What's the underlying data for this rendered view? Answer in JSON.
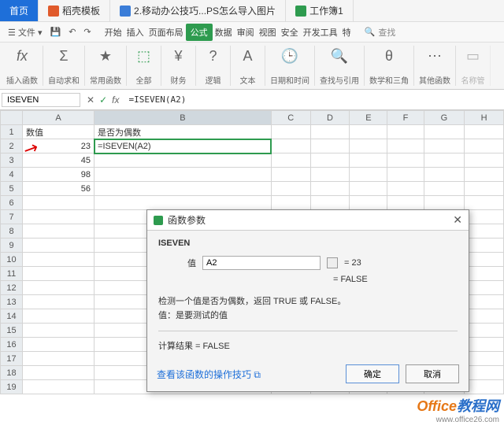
{
  "tabs": {
    "home": "首页",
    "t1": "稻壳模板",
    "t2": "2.移动办公技巧...PS怎么导入图片",
    "t3": "工作簿1"
  },
  "menu": {
    "file": "文件"
  },
  "ribbon": {
    "items": [
      "开始",
      "插入",
      "页面布局",
      "公式",
      "数据",
      "审阅",
      "视图",
      "安全",
      "开发工具",
      "特"
    ],
    "search": "查找"
  },
  "toolbar": {
    "g0": "插入函数",
    "g1": "自动求和",
    "g2": "常用函数",
    "g3": "全部",
    "g4": "财务",
    "g5": "逻辑",
    "g6": "文本",
    "g7": "日期和时间",
    "g8": "查找与引用",
    "g9": "数学和三角",
    "g10": "其他函数",
    "g11": "名称管"
  },
  "fx": {
    "name": "ISEVEN",
    "formula": "=ISEVEN(A2)"
  },
  "headers": [
    "A",
    "B",
    "C",
    "D",
    "E",
    "F",
    "G",
    "H"
  ],
  "rows": [
    "1",
    "2",
    "3",
    "4",
    "5",
    "6",
    "7",
    "8",
    "9",
    "10",
    "11",
    "12",
    "13",
    "14",
    "15",
    "16",
    "17",
    "18",
    "19"
  ],
  "cells": {
    "A1": "数值",
    "B1": "是否为偶数",
    "A2": "23",
    "B2": "=ISEVEN(A2)",
    "A3": "45",
    "A4": "98",
    "A5": "56"
  },
  "dialog": {
    "title": "函数参数",
    "fname": "ISEVEN",
    "arg_label": "值",
    "arg_value": "A2",
    "arg_eval": "= 23",
    "result": "= FALSE",
    "desc1": "检测一个值是否为偶数，返回 TRUE 或 FALSE。",
    "desc2": "值：是要测试的值",
    "calc": "计算结果 = FALSE",
    "link": "查看该函数的操作技巧",
    "ok": "确定",
    "cancel": "取消"
  },
  "watermark": {
    "brand": "Office",
    "suffix": "教程网",
    "url": "www.office26.com"
  }
}
